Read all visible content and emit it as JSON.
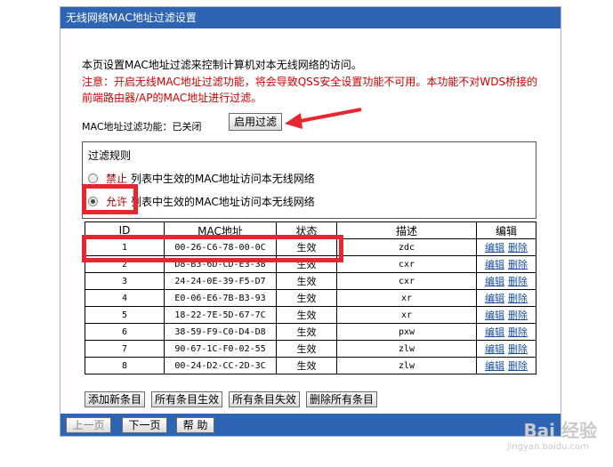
{
  "page": {
    "title": "无线网络MAC地址过滤设置"
  },
  "intro_text": "本页设置MAC地址过滤来控制计算机对本无线网络的访问。",
  "note_text": "注意：开启无线MAC地址过滤功能，将会导致QSS安全设置功能不可用。本功能不对WDS桥接的前端路由器/AP的MAC地址进行过滤。",
  "filter_status": {
    "label": "MAC地址过滤功能：",
    "value": "已关闭",
    "enable_button": "启用过滤"
  },
  "rules": {
    "title": "过滤规则",
    "options": [
      {
        "name": "禁止",
        "text": "列表中生效的MAC地址访问本无线网络",
        "selected": false
      },
      {
        "name": "允许",
        "text": "列表中生效的MAC地址访问本无线网络",
        "selected": true
      }
    ]
  },
  "table": {
    "headers": [
      "ID",
      "MAC地址",
      "状态",
      "描述",
      "编辑"
    ],
    "edit_label": "编辑",
    "delete_label": "删除",
    "rows": [
      {
        "id": "1",
        "mac": "00-26-C6-78-00-0C",
        "status": "生效",
        "desc": "zdc"
      },
      {
        "id": "2",
        "mac": "D8-B3-6D-CD-E3-38",
        "status": "生效",
        "desc": "cxr"
      },
      {
        "id": "3",
        "mac": "24-24-0E-39-F5-D7",
        "status": "生效",
        "desc": "cxr"
      },
      {
        "id": "4",
        "mac": "E0-06-E6-7B-B3-93",
        "status": "生效",
        "desc": "xr"
      },
      {
        "id": "5",
        "mac": "18-22-7E-5D-67-7C",
        "status": "生效",
        "desc": "xr"
      },
      {
        "id": "6",
        "mac": "38-59-F9-C0-D4-D8",
        "status": "生效",
        "desc": "pxw"
      },
      {
        "id": "7",
        "mac": "90-67-1C-F0-02-55",
        "status": "生效",
        "desc": "zlw"
      },
      {
        "id": "8",
        "mac": "00-24-D2-CC-2D-3C",
        "status": "生效",
        "desc": "zlw"
      }
    ]
  },
  "actions": [
    "添加新条目",
    "所有条目生效",
    "所有条目失效",
    "删除所有条目"
  ],
  "nav": {
    "prev": "上一页",
    "next": "下一页",
    "help": "帮 助"
  },
  "watermark": {
    "brand": "Bai 经验",
    "url": "jingyan.baidu.com"
  },
  "colors": {
    "title_bar": "#2d64b4",
    "note": "#d10000",
    "annotation": "#e8262f",
    "link": "#1a4fa0"
  }
}
